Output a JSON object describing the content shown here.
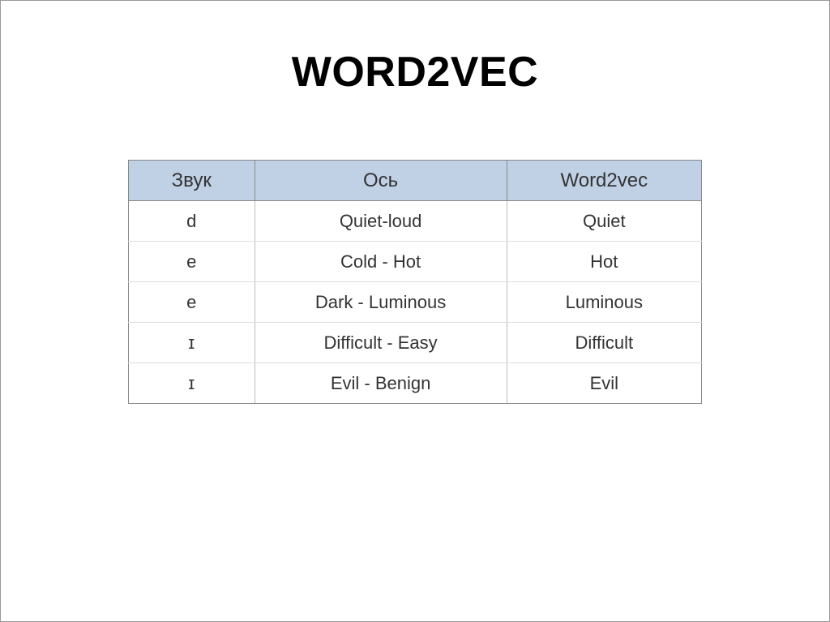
{
  "title": "WORD2VEC",
  "table": {
    "headers": [
      "Звук",
      "Ось",
      "Word2vec"
    ],
    "rows": [
      {
        "c0": "d",
        "c1": "Quiet-loud",
        "c2": "Quiet"
      },
      {
        "c0": "e",
        "c1": "Cold - Hot",
        "c2": "Hot"
      },
      {
        "c0": "e",
        "c1": "Dark - Luminous",
        "c2": "Luminous"
      },
      {
        "c0": "ɪ",
        "c1": "Difficult - Easy",
        "c2": "Difficult"
      },
      {
        "c0": "ɪ",
        "c1": "Evil - Benign",
        "c2": "Evil"
      }
    ]
  }
}
